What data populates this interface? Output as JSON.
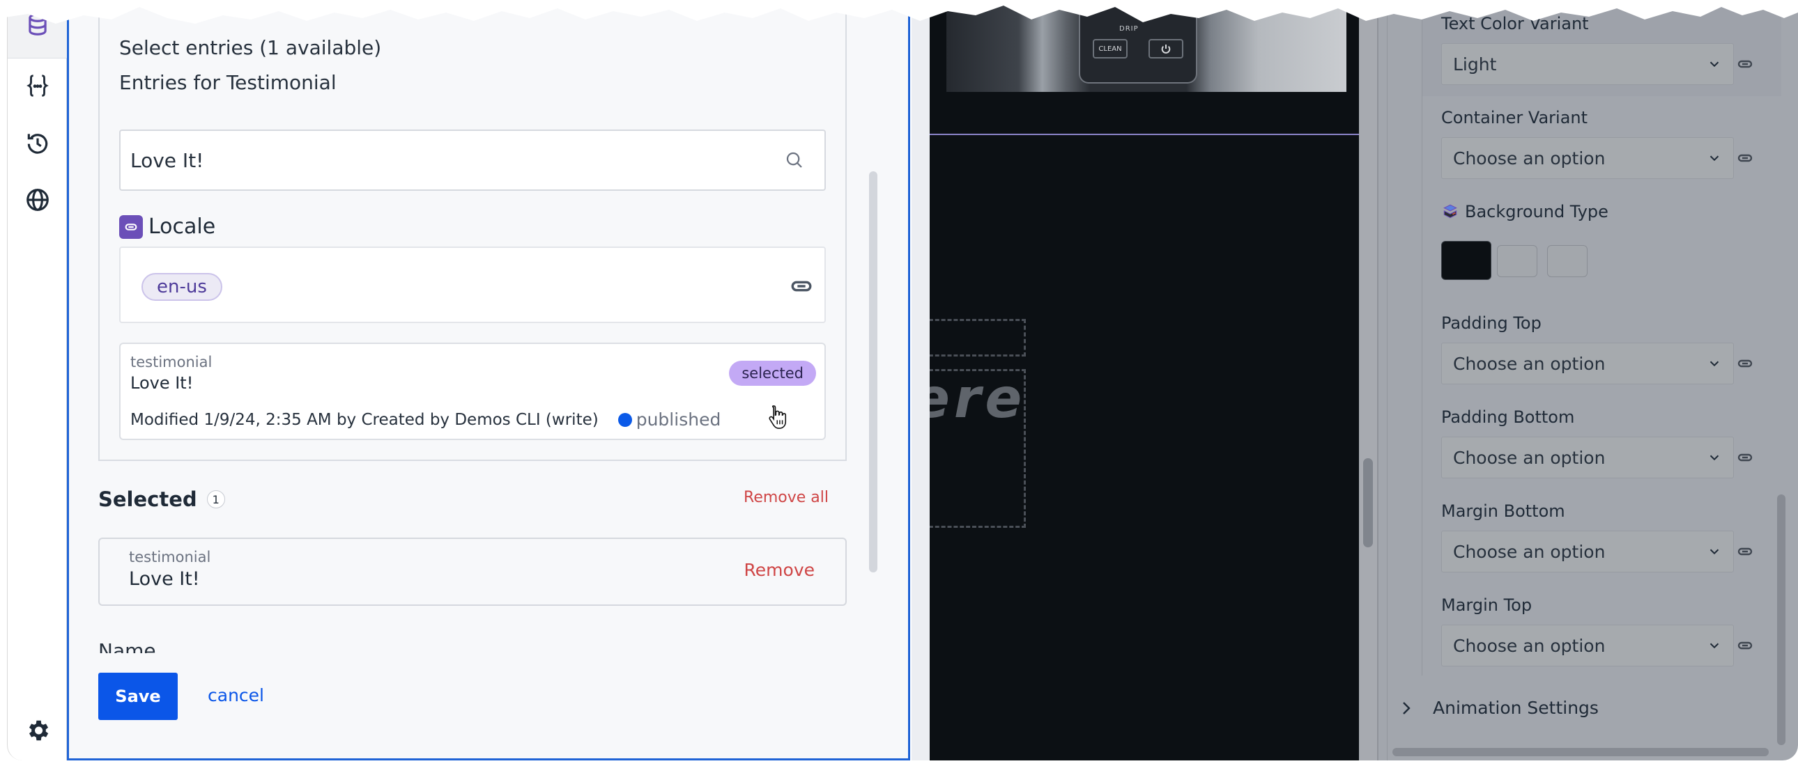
{
  "rail": {
    "icons": [
      "database-icon",
      "variables-icon",
      "history-icon",
      "globe-icon",
      "settings-icon"
    ]
  },
  "picker": {
    "title": "Select entries (1 available)",
    "subtitle": "Entries for Testimonial",
    "search_value": "Love It!",
    "locale_label": "Locale",
    "locale_value": "en-us",
    "entry": {
      "type": "testimonial",
      "title": "Love It!",
      "meta": "Modified 1/9/24, 2:35 AM by Created by Demos CLI (write)",
      "status": "published",
      "badge": "selected"
    }
  },
  "selected": {
    "heading": "Selected",
    "count": "1",
    "remove_all": "Remove all",
    "items": [
      {
        "type": "testimonial",
        "title": "Love It!",
        "action": "Remove"
      }
    ]
  },
  "form": {
    "next_field_label": "Name"
  },
  "footer": {
    "save_label": "Save",
    "cancel_label": "cancel"
  },
  "canvas": {
    "image_labels": {
      "brand": "DRIP",
      "clean": "CLEAN"
    },
    "text_fragment": "ere"
  },
  "settings": {
    "fields": [
      {
        "label": "Text Color Variant",
        "value": "Light"
      },
      {
        "label": "Container Variant",
        "value": "Choose an option"
      },
      {
        "label": "Padding Top",
        "value": "Choose an option"
      },
      {
        "label": "Padding Bottom",
        "value": "Choose an option"
      },
      {
        "label": "Margin Bottom",
        "value": "Choose an option"
      },
      {
        "label": "Margin Top",
        "value": "Choose an option"
      }
    ],
    "background_type": {
      "label": "Background Type",
      "swatches": [
        "#0c1014",
        "#a3a7ac",
        "#a3a7ac"
      ],
      "selected_index": 0
    },
    "animation_section": "Animation Settings"
  },
  "colors": {
    "accent": "#0b56e8",
    "danger": "#cf4545",
    "locale_purple": "#6b4fb8",
    "selected_badge": "#c3a9f5",
    "canvas_bg": "#0c1014",
    "published_dot": "#0b5ae8"
  }
}
